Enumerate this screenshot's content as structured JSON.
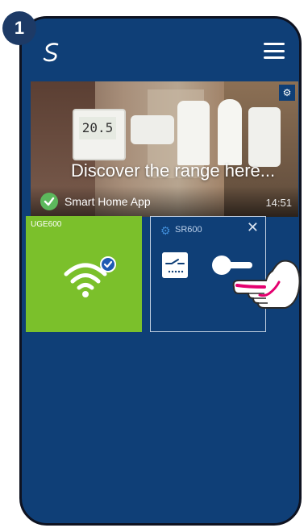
{
  "step": "1",
  "banner": {
    "title": "Discover the range here...",
    "app_label": "Smart Home App",
    "time": "14:51",
    "thermostat_reading": "20.5"
  },
  "tiles": [
    {
      "label": "UGE600",
      "icon": "wifi-icon",
      "status": "connected"
    },
    {
      "label": "SR600",
      "icon": "relay-switch-icon",
      "toggle": "off"
    }
  ],
  "colors": {
    "app_bg": "#0f3f77",
    "ugw_tile": "#7bc02b",
    "check_green": "#5cb85c",
    "hand_accent": "#e4006f"
  }
}
